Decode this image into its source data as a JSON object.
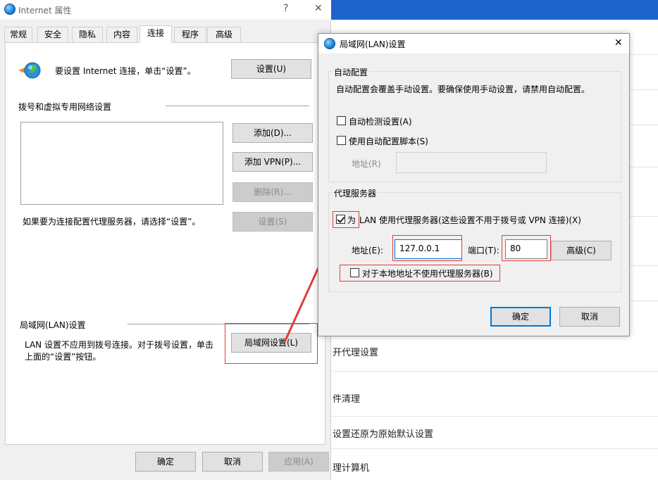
{
  "background": {
    "items": [
      "开代理设置",
      "件清理",
      "设置还原为原始默认设置",
      "理计算机"
    ]
  },
  "inet": {
    "title": "Internet 属性",
    "help": "?",
    "close": "✕",
    "tabs": [
      "常规",
      "安全",
      "隐私",
      "内容",
      "连接",
      "程序",
      "高级"
    ],
    "setup_text": "要设置 Internet 连接，单击“设置”。",
    "setup_button": "设置(U)",
    "dialup_heading": "拨号和虚拟专用网络设置",
    "add_button": "添加(D)...",
    "add_vpn_button": "添加 VPN(P)...",
    "delete_button": "删除(R)...",
    "proxy_hint": "如果要为连接配置代理服务器，请选择“设置”。",
    "settings_button": "设置(S)",
    "lan_heading": "局域网(LAN)设置",
    "lan_desc_1": "LAN 设置不应用到拨号连接。对于拨号设置，单击",
    "lan_desc_2": "上面的“设置”按钮。",
    "lan_button": "局域网设置(L)",
    "ok": "确定",
    "cancel": "取消",
    "apply": "应用(A)"
  },
  "lan": {
    "title": "局域网(LAN)设置",
    "close": "✕",
    "auto_heading": "自动配置",
    "auto_desc": "自动配置会覆盖手动设置。要确保使用手动设置，请禁用自动配置。",
    "auto_detect": "自动检测设置(A)",
    "auto_script": "使用自动配置脚本(S)",
    "address_label": "地址(R)",
    "address_value": "",
    "proxy_heading": "代理服务器",
    "proxy_checkbox_prefix": "为",
    "proxy_checkbox_text": "LAN 使用代理服务器(这些设置不用于拨号或 VPN 连接)(X)",
    "proxy_checked": true,
    "proxy_addr_label": "地址(E):",
    "proxy_addr_value": "127.0.0.1",
    "port_label": "端口(T):",
    "port_value": "80",
    "advanced_button": "高级(C)",
    "bypass_local": "对于本地地址不使用代理服务器(B)",
    "ok": "确定",
    "cancel": "取消"
  },
  "colors": {
    "annotation_red": "#e33b3b",
    "accent_blue": "#0078d7",
    "bg_topbar": "#1e63c9"
  }
}
